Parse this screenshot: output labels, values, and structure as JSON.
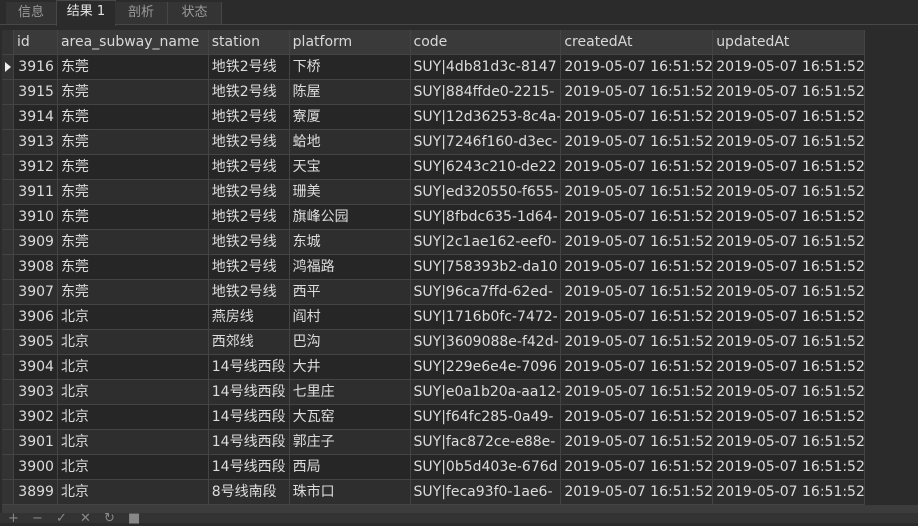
{
  "tabs": [
    "信息",
    "结果 1",
    "剖析",
    "状态"
  ],
  "columns": [
    "id",
    "area_subway_name",
    "station",
    "platform",
    "code",
    "createdAt",
    "updatedAt"
  ],
  "rows": [
    [
      "3916",
      "东莞",
      "地铁2号线",
      "下桥",
      "SUY|4db81d3c-8147",
      "2019-05-07 16:51:52",
      "2019-05-07 16:51:52"
    ],
    [
      "3915",
      "东莞",
      "地铁2号线",
      "陈屋",
      "SUY|884ffde0-2215-",
      "2019-05-07 16:51:52",
      "2019-05-07 16:51:52"
    ],
    [
      "3914",
      "东莞",
      "地铁2号线",
      "寮厦",
      "SUY|12d36253-8c4a-",
      "2019-05-07 16:51:52",
      "2019-05-07 16:51:52"
    ],
    [
      "3913",
      "东莞",
      "地铁2号线",
      "蛤地",
      "SUY|7246f160-d3ec-",
      "2019-05-07 16:51:52",
      "2019-05-07 16:51:52"
    ],
    [
      "3912",
      "东莞",
      "地铁2号线",
      "天宝",
      "SUY|6243c210-de22",
      "2019-05-07 16:51:52",
      "2019-05-07 16:51:52"
    ],
    [
      "3911",
      "东莞",
      "地铁2号线",
      "珊美",
      "SUY|ed320550-f655-",
      "2019-05-07 16:51:52",
      "2019-05-07 16:51:52"
    ],
    [
      "3910",
      "东莞",
      "地铁2号线",
      "旗峰公园",
      "SUY|8fbdc635-1d64-",
      "2019-05-07 16:51:52",
      "2019-05-07 16:51:52"
    ],
    [
      "3909",
      "东莞",
      "地铁2号线",
      "东城",
      "SUY|2c1ae162-eef0-",
      "2019-05-07 16:51:52",
      "2019-05-07 16:51:52"
    ],
    [
      "3908",
      "东莞",
      "地铁2号线",
      "鸿福路",
      "SUY|758393b2-da10",
      "2019-05-07 16:51:52",
      "2019-05-07 16:51:52"
    ],
    [
      "3907",
      "东莞",
      "地铁2号线",
      "西平",
      "SUY|96ca7ffd-62ed-",
      "2019-05-07 16:51:52",
      "2019-05-07 16:51:52"
    ],
    [
      "3906",
      "北京",
      "燕房线",
      "阎村",
      "SUY|1716b0fc-7472-",
      "2019-05-07 16:51:52",
      "2019-05-07 16:51:52"
    ],
    [
      "3905",
      "北京",
      "西郊线",
      "巴沟",
      "SUY|3609088e-f42d-",
      "2019-05-07 16:51:52",
      "2019-05-07 16:51:52"
    ],
    [
      "3904",
      "北京",
      "14号线西段",
      "大井",
      "SUY|229e6e4e-7096",
      "2019-05-07 16:51:52",
      "2019-05-07 16:51:52"
    ],
    [
      "3903",
      "北京",
      "14号线西段",
      "七里庄",
      "SUY|e0a1b20a-aa12-",
      "2019-05-07 16:51:52",
      "2019-05-07 16:51:52"
    ],
    [
      "3902",
      "北京",
      "14号线西段",
      "大瓦窑",
      "SUY|f64fc285-0a49-",
      "2019-05-07 16:51:52",
      "2019-05-07 16:51:52"
    ],
    [
      "3901",
      "北京",
      "14号线西段",
      "郭庄子",
      "SUY|fac872ce-e88e-",
      "2019-05-07 16:51:52",
      "2019-05-07 16:51:52"
    ],
    [
      "3900",
      "北京",
      "14号线西段",
      "西局",
      "SUY|0b5d403e-676d",
      "2019-05-07 16:51:52",
      "2019-05-07 16:51:52"
    ],
    [
      "3899",
      "北京",
      "8号线南段",
      "珠市口",
      "SUY|feca93f0-1ae6-",
      "2019-05-07 16:51:52",
      "2019-05-07 16:51:52"
    ]
  ],
  "toolbar": {
    "add": "+",
    "remove": "−",
    "apply": "✓",
    "cancel": "✕",
    "refresh": "↻",
    "stop": "■"
  }
}
